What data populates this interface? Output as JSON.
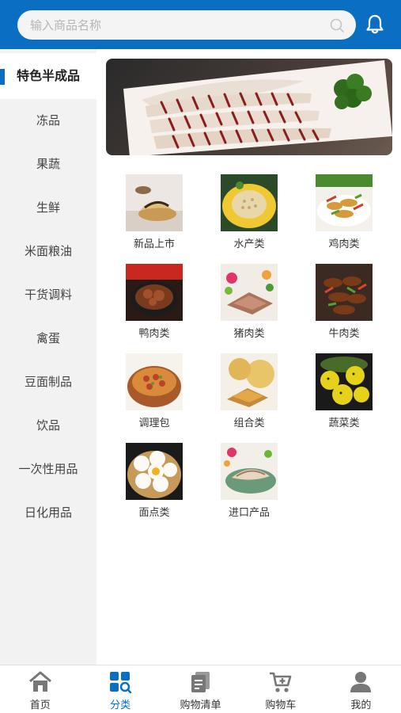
{
  "search": {
    "placeholder": "输入商品名称"
  },
  "sidebar": {
    "items": [
      {
        "label": "特色半成品",
        "active": true
      },
      {
        "label": "冻品"
      },
      {
        "label": "果蔬"
      },
      {
        "label": "生鲜"
      },
      {
        "label": "米面粮油"
      },
      {
        "label": "干货调料"
      },
      {
        "label": "禽蛋"
      },
      {
        "label": "豆面制品"
      },
      {
        "label": "饮品"
      },
      {
        "label": "一次性用品"
      },
      {
        "label": "日化用品"
      }
    ]
  },
  "categories": [
    {
      "label": "新品上市"
    },
    {
      "label": "水产类"
    },
    {
      "label": "鸡肉类"
    },
    {
      "label": "鸭肉类"
    },
    {
      "label": "猪肉类"
    },
    {
      "label": "牛肉类"
    },
    {
      "label": "调理包"
    },
    {
      "label": "组合类"
    },
    {
      "label": "蔬菜类"
    },
    {
      "label": "面点类"
    },
    {
      "label": "进口产品"
    }
  ],
  "tabbar": {
    "items": [
      {
        "label": "首页",
        "icon": "home-icon"
      },
      {
        "label": "分类",
        "icon": "category-icon",
        "active": true
      },
      {
        "label": "购物清单",
        "icon": "shopping-list-icon"
      },
      {
        "label": "购物车",
        "icon": "cart-icon"
      },
      {
        "label": "我的",
        "icon": "user-icon"
      }
    ]
  },
  "colors": {
    "accent": "#0a6fc2",
    "sidebar_bg": "#f2f2f2",
    "header_bg": "#0a6fc2"
  }
}
